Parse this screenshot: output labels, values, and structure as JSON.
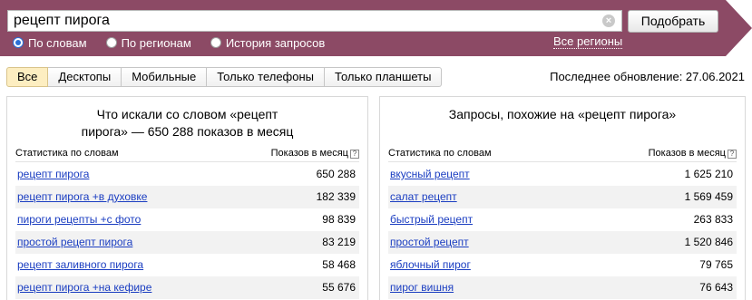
{
  "search": {
    "query": "рецепт пирога",
    "clear_glyph": "×",
    "submit_label": "Подобрать",
    "modes": [
      {
        "label": "По словам",
        "selected": true
      },
      {
        "label": "По регионам",
        "selected": false
      },
      {
        "label": "История запросов",
        "selected": false
      }
    ],
    "regions_link": "Все регионы"
  },
  "tabs": [
    {
      "label": "Все",
      "active": true
    },
    {
      "label": "Десктопы",
      "active": false
    },
    {
      "label": "Мобильные",
      "active": false
    },
    {
      "label": "Только телефоны",
      "active": false
    },
    {
      "label": "Только планшеты",
      "active": false
    }
  ],
  "last_update": "Последнее обновление: 27.06.2021",
  "left_panel": {
    "title": "Что искали со словом «рецепт пирога» — 650 288 показов в месяц",
    "col_words": "Статистика по словам",
    "col_shows": "Показов в месяц",
    "rows": [
      {
        "query": "рецепт пирога",
        "count": "650 288"
      },
      {
        "query": "рецепт пирога +в духовке",
        "count": "182 339"
      },
      {
        "query": "пироги рецепты +с фото",
        "count": "98 839"
      },
      {
        "query": "простой рецепт пирога",
        "count": "83 219"
      },
      {
        "query": "рецепт заливного пирога",
        "count": "58 468"
      },
      {
        "query": "рецепт пирога +на кефире",
        "count": "55 676"
      }
    ]
  },
  "right_panel": {
    "title": "Запросы, похожие на «рецепт пирога»",
    "col_words": "Статистика по словам",
    "col_shows": "Показов в месяц",
    "rows": [
      {
        "query": "вкусный рецепт",
        "count": "1 625 210"
      },
      {
        "query": "салат рецепт",
        "count": "1 569 459"
      },
      {
        "query": "быстрый рецепт",
        "count": "263 833"
      },
      {
        "query": "простой рецепт",
        "count": "1 520 846"
      },
      {
        "query": "яблочный пирог",
        "count": "79 765"
      },
      {
        "query": "пирог вишня",
        "count": "76 643"
      }
    ]
  },
  "colors": {
    "band": "#8c4a65",
    "link": "#1a3dc1",
    "active_tab": "#fdeec1"
  },
  "icons": {
    "clear": "clear-icon",
    "help": "help-icon"
  }
}
